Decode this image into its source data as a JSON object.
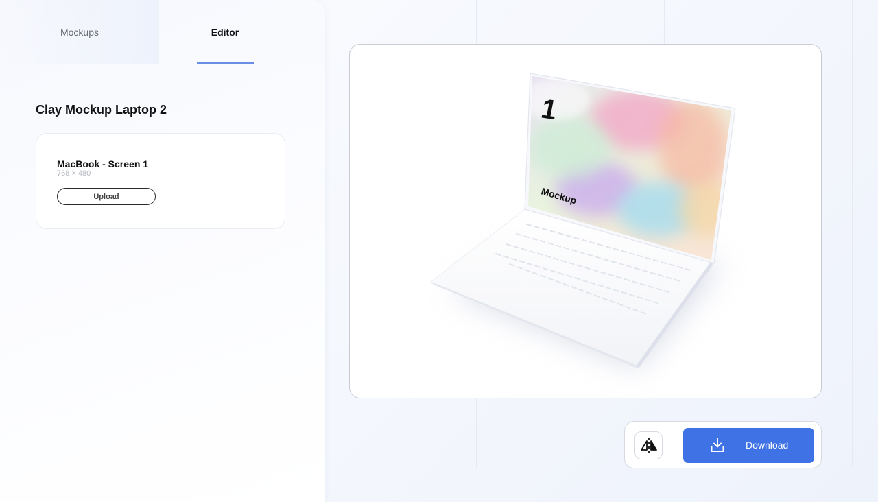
{
  "tabs": [
    {
      "label": "Mockups",
      "active": false
    },
    {
      "label": "Editor",
      "active": true
    }
  ],
  "page_title": "Clay Mockup Laptop 2",
  "screens": [
    {
      "name": "MacBook - Screen 1",
      "size": "768 × 480",
      "upload_label": "Upload"
    }
  ],
  "preview": {
    "screen_number": "1",
    "screen_text": "Mockup"
  },
  "toolbar": {
    "flip_icon": "flip-horizontal-icon",
    "download_icon": "download-icon",
    "download_label": "Download"
  },
  "colors": {
    "accent": "#3f72e4",
    "tab_underline": "#6a8ee6"
  }
}
